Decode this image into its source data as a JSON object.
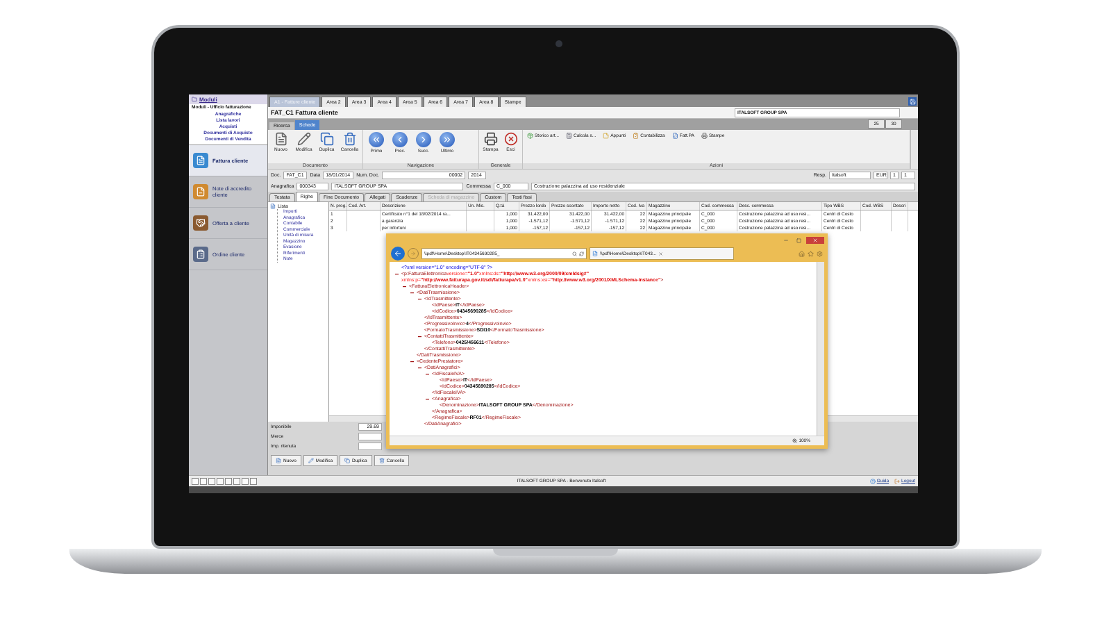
{
  "sidebar": {
    "header": "Moduli",
    "subtitle": "Moduli - Ufficio fatturazione",
    "links": [
      "Anagrafiche",
      "Lista lavori",
      "Acquisti",
      "Documenti di Acquisto",
      "Documenti di Vendita"
    ],
    "items": [
      {
        "label": "Fattura cliente",
        "selected": true
      },
      {
        "label": "Note di accredito cliente",
        "selected": false
      },
      {
        "label": "Offerta a cliente",
        "selected": false
      },
      {
        "label": "Ordine cliente",
        "selected": false
      }
    ]
  },
  "area_tabs": [
    {
      "label": "A1 - Fatture cliente",
      "selected": true
    },
    {
      "label": "Area 2",
      "selected": false
    },
    {
      "label": "Area 3",
      "selected": false
    },
    {
      "label": "Area 4",
      "selected": false
    },
    {
      "label": "Area 5",
      "selected": false
    },
    {
      "label": "Area 6",
      "selected": false
    },
    {
      "label": "Area 7",
      "selected": false
    },
    {
      "label": "Area 8",
      "selected": false
    },
    {
      "label": "Stampe",
      "selected": false
    }
  ],
  "document": {
    "title": "FAT_C1 Fattura cliente",
    "company": "ITALSOFT GROUP SPA",
    "page_buttons": [
      "25",
      "30"
    ]
  },
  "view_tabs": [
    {
      "label": "Ricerca",
      "selected": false
    },
    {
      "label": "Schede",
      "selected": true
    }
  ],
  "toolbar": [
    {
      "kind": "large",
      "label": "Documento",
      "buttons": [
        "Nuovo",
        "Modifica",
        "Duplica",
        "Cancella"
      ]
    },
    {
      "kind": "large",
      "label": "Navigazione",
      "buttons": [
        "Primo",
        "Prec.",
        "Succ.",
        "Ultimo"
      ]
    },
    {
      "kind": "large",
      "label": "Generale",
      "buttons": [
        "Stampa",
        "Esci"
      ]
    },
    {
      "kind": "small",
      "label": "Azioni",
      "buttons": [
        "Storico art...",
        "Calcola s...",
        "Appunti",
        "Contabilizza",
        "Fatt.PA",
        "Stampe"
      ]
    }
  ],
  "doc_row": {
    "left": [
      {
        "label": "Doc.",
        "value": "FAT_C1"
      },
      {
        "label": "Data",
        "value": "18/01/2014"
      },
      {
        "label": "Num. Doc.",
        "value": "00002"
      },
      {
        "value": "2014"
      }
    ],
    "right": [
      {
        "label": "Resp.",
        "value": "Italsoft"
      },
      {
        "value": "EUR"
      },
      {
        "value": "1"
      },
      {
        "value": "1"
      }
    ]
  },
  "anagrafica_row": [
    {
      "label": "Anagrafica",
      "value": "000343"
    },
    {
      "value": "ITALSOFT GROUP SPA"
    },
    {
      "label": "Commessa",
      "value": "C_000"
    },
    {
      "value": "Costruzione palazzina ad uso residenziale"
    }
  ],
  "detail_tabs": [
    {
      "label": "Testata",
      "selected": false,
      "disabled": false
    },
    {
      "label": "Righe",
      "selected": true,
      "disabled": false
    },
    {
      "label": "Fine Documento",
      "selected": false,
      "disabled": false
    },
    {
      "label": "Allegati",
      "selected": false,
      "disabled": false
    },
    {
      "label": "Scadenze",
      "selected": false,
      "disabled": false
    },
    {
      "label": "Scheda di magazzino",
      "selected": false,
      "disabled": true
    },
    {
      "label": "Custom",
      "selected": false,
      "disabled": false
    },
    {
      "label": "Testi fissi",
      "selected": false,
      "disabled": false
    }
  ],
  "tree": [
    {
      "label": "Lista",
      "children": [
        {
          "label": "Importi"
        },
        {
          "label": "Anagrafica"
        },
        {
          "label": "Contabile"
        },
        {
          "label": "Commerciale"
        },
        {
          "label": "Unità di misura"
        },
        {
          "label": "Magazzino"
        },
        {
          "label": "Evasione"
        },
        {
          "label": "Riferimenti"
        },
        {
          "label": "Note"
        }
      ]
    }
  ],
  "table": {
    "columns": [
      "N. prog.",
      "Cod. Art.",
      "Descrizione",
      "Un. Mis.",
      "Q.tà",
      "Prezzo lordo",
      "Prezzo scontato",
      "Importo netto",
      "Cod. Iva",
      "Magazzino",
      "Cod. commessa",
      "Desc. commessa",
      "Tipo WBS",
      "Cod. WBS",
      "Descri"
    ],
    "rows": [
      [
        "1",
        "",
        "Certificato n°1 del 18/02/2014 ra...",
        "",
        "1,000",
        "31.422,00",
        "31.422,00",
        "31.422,00",
        "22",
        "Magazzino principale",
        "C_000",
        "Costruzione palazzina ad uso resi...",
        "Centri di Costo",
        "",
        ""
      ],
      [
        "2",
        "",
        "a garanzia",
        "",
        "1,000",
        "-1.571,12",
        "-1.571,12",
        "-1.571,12",
        "22",
        "Magazzino principale",
        "C_000",
        "Costruzione palazzina ad uso resi...",
        "Centri di Costo",
        "",
        ""
      ],
      [
        "3",
        "",
        "per infortuni",
        "",
        "1,000",
        "-157,12",
        "-157,12",
        "-157,12",
        "22",
        "Magazzino principale",
        "C_000",
        "Costruzione palazzina ad uso resi...",
        "Centri di Costo",
        "",
        ""
      ]
    ]
  },
  "totals": [
    {
      "label": "Imponibile",
      "value": "29.69"
    },
    {
      "label": "Merce"
    },
    {
      "label": "Imp. ritenuta"
    }
  ],
  "bottom_buttons": [
    "Nuovo",
    "Modifica",
    "Duplica",
    "Cancella"
  ],
  "status_bar": {
    "message": "ITALSOFT GROUP SPA - Benvenuto Italsoft",
    "links": [
      "Guida",
      "Logout"
    ]
  },
  "browser": {
    "address": "\\\\pdf\\Home\\Desktop\\IT04345690285_",
    "tab": "\\\\pdf\\Home\\Desktop\\IT043...",
    "zoom": "100%",
    "xml": [
      {
        "toggle": false,
        "open": [
          [
            {
              "kind": "pi",
              "text": "<?xml version=\"1.0\" encoding=\"UTF-8\" ?>"
            }
          ]
        ]
      },
      {
        "toggle": true,
        "open": [
          [
            {
              "kind": "tag",
              "text": "<p:FatturaElettronica"
            },
            {
              "kind": "attr",
              "text": " versione="
            },
            {
              "kind": "aval",
              "text": "\"1.0\""
            },
            {
              "kind": "attr",
              "text": " xmlns:ds="
            },
            {
              "kind": "aval",
              "text": "\"http://www.w3.org/2000/09/xmldsig#\""
            }
          ],
          [
            {
              "kind": "attr",
              "text": "xmlns:p="
            },
            {
              "kind": "aval",
              "text": "\"http://www.fatturapa.gov.it/sdi/fatturapa/v1.0\""
            },
            {
              "kind": "attr",
              "text": " xmlns:xsi="
            },
            {
              "kind": "aval",
              "text": "\"http://www.w3.org/2001/XMLSchema-instance\""
            },
            {
              "kind": "tag",
              "text": ">"
            }
          ]
        ],
        "children": [
          {
            "toggle": true,
            "open": [
              [
                {
                  "kind": "tag",
                  "text": "<FatturaElettronicaHeader>"
                }
              ]
            ],
            "children": [
              {
                "toggle": true,
                "open": [
                  [
                    {
                      "kind": "tag",
                      "text": "<DatiTrasmissione>"
                    }
                  ]
                ],
                "children": [
                  {
                    "toggle": true,
                    "open": [
                      [
                        {
                          "kind": "tag",
                          "text": "<IdTrasmittente>"
                        }
                      ]
                    ],
                    "children": [
                      {
                        "toggle": false,
                        "open": [
                          [
                            {
                              "kind": "tag",
                              "text": "<IdPaese>"
                            },
                            {
                              "kind": "text",
                              "text": "IT"
                            },
                            {
                              "kind": "tag",
                              "text": "</IdPaese>"
                            }
                          ]
                        ]
                      },
                      {
                        "toggle": false,
                        "open": [
                          [
                            {
                              "kind": "tag",
                              "text": "<IdCodice>"
                            },
                            {
                              "kind": "text",
                              "text": "04345690285"
                            },
                            {
                              "kind": "tag",
                              "text": "</IdCodice>"
                            }
                          ]
                        ]
                      }
                    ],
                    "close": [
                      {
                        "kind": "tag",
                        "text": "</IdTrasmittente>"
                      }
                    ]
                  },
                  {
                    "toggle": false,
                    "open": [
                      [
                        {
                          "kind": "tag",
                          "text": "<ProgressivoInvio>"
                        },
                        {
                          "kind": "text",
                          "text": "4"
                        },
                        {
                          "kind": "tag",
                          "text": "</ProgressivoInvio>"
                        }
                      ]
                    ]
                  },
                  {
                    "toggle": false,
                    "open": [
                      [
                        {
                          "kind": "tag",
                          "text": "<FormatoTrasmissione>"
                        },
                        {
                          "kind": "text",
                          "text": "SDI10"
                        },
                        {
                          "kind": "tag",
                          "text": "</FormatoTrasmissione>"
                        }
                      ]
                    ]
                  },
                  {
                    "toggle": true,
                    "open": [
                      [
                        {
                          "kind": "tag",
                          "text": "<ContattiTrasmittente>"
                        }
                      ]
                    ],
                    "children": [
                      {
                        "toggle": false,
                        "open": [
                          [
                            {
                              "kind": "tag",
                              "text": "<Telefono>"
                            },
                            {
                              "kind": "text",
                              "text": "0425/456611"
                            },
                            {
                              "kind": "tag",
                              "text": "</Telefono>"
                            }
                          ]
                        ]
                      }
                    ],
                    "close": [
                      {
                        "kind": "tag",
                        "text": "</ContattiTrasmittente>"
                      }
                    ]
                  }
                ],
                "close": [
                  {
                    "kind": "tag",
                    "text": "</DatiTrasmissione>"
                  }
                ]
              },
              {
                "toggle": true,
                "open": [
                  [
                    {
                      "kind": "tag",
                      "text": "<CedentePrestatore>"
                    }
                  ]
                ],
                "children": [
                  {
                    "toggle": true,
                    "open": [
                      [
                        {
                          "kind": "tag",
                          "text": "<DatiAnagrafici>"
                        }
                      ]
                    ],
                    "children": [
                      {
                        "toggle": true,
                        "open": [
                          [
                            {
                              "kind": "tag",
                              "text": "<IdFiscaleIVA>"
                            }
                          ]
                        ],
                        "children": [
                          {
                            "toggle": false,
                            "open": [
                              [
                                {
                                  "kind": "tag",
                                  "text": "<IdPaese>"
                                },
                                {
                                  "kind": "text",
                                  "text": "IT"
                                },
                                {
                                  "kind": "tag",
                                  "text": "</IdPaese>"
                                }
                              ]
                            ]
                          },
                          {
                            "toggle": false,
                            "open": [
                              [
                                {
                                  "kind": "tag",
                                  "text": "<IdCodice>"
                                },
                                {
                                  "kind": "text",
                                  "text": "04345690285"
                                },
                                {
                                  "kind": "tag",
                                  "text": "</IdCodice>"
                                }
                              ]
                            ]
                          }
                        ],
                        "close": [
                          {
                            "kind": "tag",
                            "text": "</IdFiscaleIVA>"
                          }
                        ]
                      },
                      {
                        "toggle": true,
                        "open": [
                          [
                            {
                              "kind": "tag",
                              "text": "<Anagrafica>"
                            }
                          ]
                        ],
                        "children": [
                          {
                            "toggle": false,
                            "open": [
                              [
                                {
                                  "kind": "tag",
                                  "text": "<Denominazione>"
                                },
                                {
                                  "kind": "text",
                                  "text": "ITALSOFT GROUP SPA"
                                },
                                {
                                  "kind": "tag",
                                  "text": "</Denominazione>"
                                }
                              ]
                            ]
                          }
                        ],
                        "close": [
                          {
                            "kind": "tag",
                            "text": "</Anagrafica>"
                          }
                        ]
                      },
                      {
                        "toggle": false,
                        "open": [
                          [
                            {
                              "kind": "tag",
                              "text": "<RegimeFiscale>"
                            },
                            {
                              "kind": "text",
                              "text": "RF01"
                            },
                            {
                              "kind": "tag",
                              "text": "</RegimeFiscale>"
                            }
                          ]
                        ]
                      }
                    ],
                    "close": [
                      {
                        "kind": "tag",
                        "text": "</DatiAnagrafici>"
                      }
                    ]
                  }
                ]
              }
            ]
          }
        ]
      }
    ]
  }
}
